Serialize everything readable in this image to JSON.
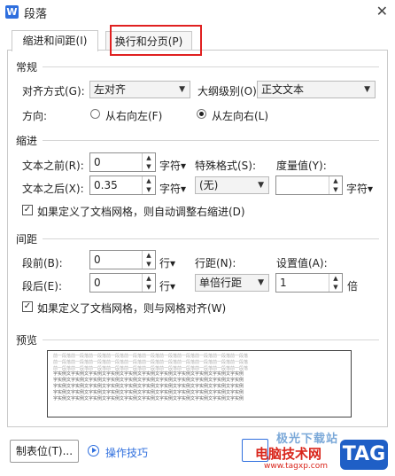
{
  "window": {
    "title": "段落",
    "app_icon": "W"
  },
  "tabs": [
    {
      "label": "缩进和间距(I)"
    },
    {
      "label": "换行和分页(P)"
    }
  ],
  "general": {
    "section": "常规",
    "align_label": "对齐方式(G):",
    "align_value": "左对齐",
    "outline_label": "大纲级别(O):",
    "outline_value": "正文文本",
    "direction_label": "方向:",
    "rtl_label": "从右向左(F)",
    "ltr_label": "从左向右(L)",
    "direction_selected": "ltr"
  },
  "indent": {
    "section": "缩进",
    "before_label": "文本之前(R):",
    "before_value": "0",
    "before_unit": "字符▾",
    "after_label": "文本之后(X):",
    "after_value": "0.35",
    "after_unit": "字符▾",
    "special_label": "特殊格式(S):",
    "special_value": "(无)",
    "measure_label": "度量值(Y):",
    "measure_value": "",
    "measure_unit": "字符▾",
    "grid_check_label": "如果定义了文档网格，则自动调整右缩进(D)",
    "grid_checked": true
  },
  "spacing": {
    "section": "间距",
    "before_label": "段前(B):",
    "before_value": "0",
    "before_unit": "行▾",
    "after_label": "段后(E):",
    "after_value": "0",
    "after_unit": "行▾",
    "line_label": "行距(N):",
    "line_value": "单倍行距",
    "setting_label": "设置值(A):",
    "setting_value": "1",
    "setting_unit": "倍",
    "grid_check_label": "如果定义了文档网格，则与网格对齐(W)",
    "grid_checked": true
  },
  "preview": {
    "section": "预览",
    "prev_line": "前一段落前一段落前一段落前一段落前一段落前一段落前一段落前一段落前一段落前一段落前一段落",
    "sample_line": "字实例文字实例文字实例文字实例文字实例文字实例文字实例文字实例文字实例文字实例文字实例"
  },
  "footer": {
    "tabs_button": "制表位(T)...",
    "tips_label": "操作技巧"
  },
  "watermark": {
    "site_name": "电脑技术网",
    "site_url": "www.tagxp.com",
    "badge": "TAG",
    "brand": "极光下载站"
  },
  "colors": {
    "accent": "#2f6fde",
    "highlight": "#e02020",
    "watermark_red": "#d9261c"
  }
}
